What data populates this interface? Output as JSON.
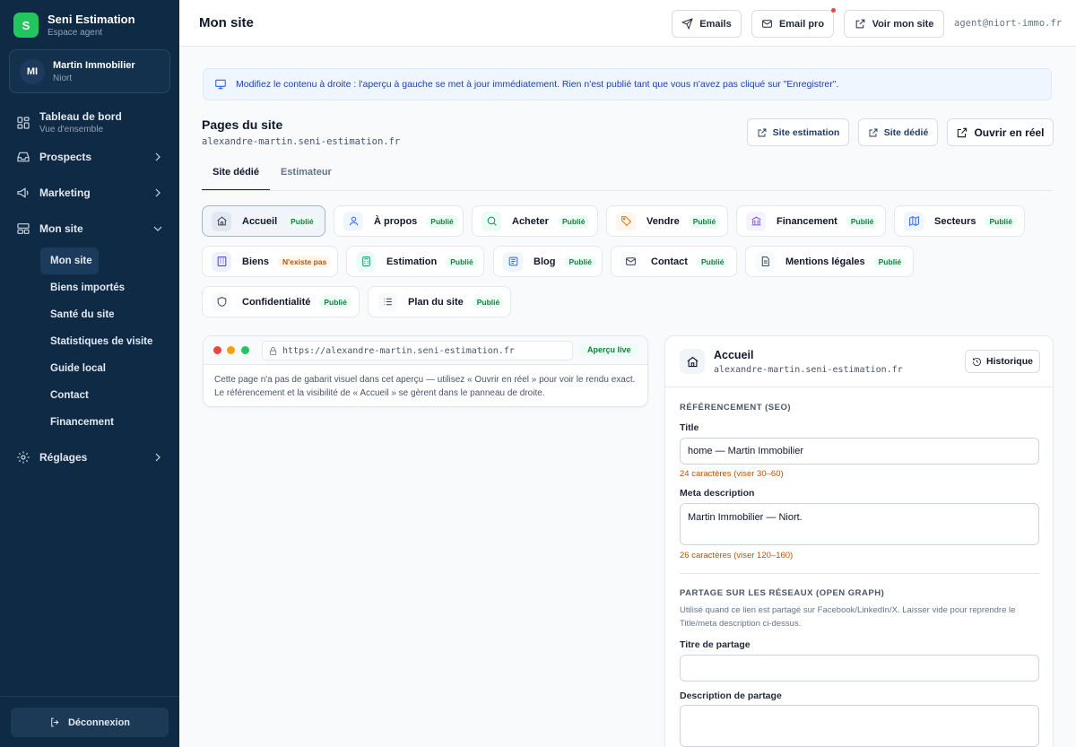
{
  "brand": {
    "logo_letter": "S",
    "name": "Seni Estimation",
    "subtitle": "Espace agent"
  },
  "agency": {
    "initials": "MI",
    "name": "Martin Immobilier",
    "city": "Niort"
  },
  "nav": {
    "dashboard": {
      "label": "Tableau de bord",
      "sub": "Vue d'ensemble"
    },
    "prospects": "Prospects",
    "marketing": "Marketing",
    "mon_site": "Mon site",
    "reglages": "Réglages",
    "sub_items": [
      "Mon site",
      "Biens importés",
      "Santé du site",
      "Statistiques de visite",
      "Guide local",
      "Contact",
      "Financement"
    ],
    "logout": "Déconnexion"
  },
  "topbar": {
    "title": "Mon site",
    "emails": "Emails",
    "email_pro": "Email pro",
    "voir_site": "Voir mon site",
    "user_email": "agent@niort-immo.fr"
  },
  "banner": "Modifiez le contenu à droite : l'aperçu à gauche se met à jour immédiatement. Rien n'est publié tant que vous n'avez pas cliqué sur \"Enregistrer\".",
  "section": {
    "title": "Pages du site",
    "domain": "alexandre-martin.seni-estimation.fr",
    "btn_site_estimation": "Site estimation",
    "btn_site_dedie": "Site dédié",
    "btn_ouvrir": "Ouvrir en réel"
  },
  "tabs": [
    "Site dédié",
    "Estimateur"
  ],
  "pages": [
    {
      "label": "Accueil",
      "status": "Publié"
    },
    {
      "label": "À propos",
      "status": "Publié"
    },
    {
      "label": "Acheter",
      "status": "Publié"
    },
    {
      "label": "Vendre",
      "status": "Publié"
    },
    {
      "label": "Financement",
      "status": "Publié"
    },
    {
      "label": "Secteurs",
      "status": "Publié"
    },
    {
      "label": "Biens",
      "status": "N'existe pas"
    },
    {
      "label": "Estimation",
      "status": "Publié"
    },
    {
      "label": "Blog",
      "status": "Publié"
    },
    {
      "label": "Contact",
      "status": "Publié"
    },
    {
      "label": "Mentions légales",
      "status": "Publié"
    },
    {
      "label": "Confidentialité",
      "status": "Publié"
    },
    {
      "label": "Plan du site",
      "status": "Publié"
    }
  ],
  "preview": {
    "url": "https://alexandre-martin.seni-estimation.fr",
    "live": "Aperçu live",
    "text": "Cette page n'a pas de gabarit visuel dans cet aperçu — utilisez « Ouvrir en réel » pour voir le rendu exact. Le référencement et la visibilité de « Accueil » se gèrent dans le panneau de droite."
  },
  "panel": {
    "title": "Accueil",
    "domain": "alexandre-martin.seni-estimation.fr",
    "history": "Historique",
    "seo_title": "RÉFÉRENCEMENT (SEO)",
    "title_label": "Title",
    "title_value": "home — Martin Immobilier",
    "title_hint": "24 caractères (viser 30–60)",
    "meta_label": "Meta description",
    "meta_value": "Martin Immobilier — Niort.",
    "meta_hint": "26 caractères (viser 120–160)",
    "og_title": "PARTAGE SUR LES RÉSEAUX (OPEN GRAPH)",
    "og_help": "Utilisé quand ce lien est partagé sur Facebook/LinkedIn/X. Laisser vide pour reprendre le Title/meta description ci-dessus.",
    "share_title_label": "Titre de partage",
    "share_title_value": "",
    "share_desc_label": "Description de partage",
    "share_desc_value": ""
  },
  "colors": {
    "sidebar": "#0f2a44",
    "accent_green": "#22c55e",
    "published": "#15803d",
    "missing": "#b45309",
    "banner": "#eff6ff"
  }
}
